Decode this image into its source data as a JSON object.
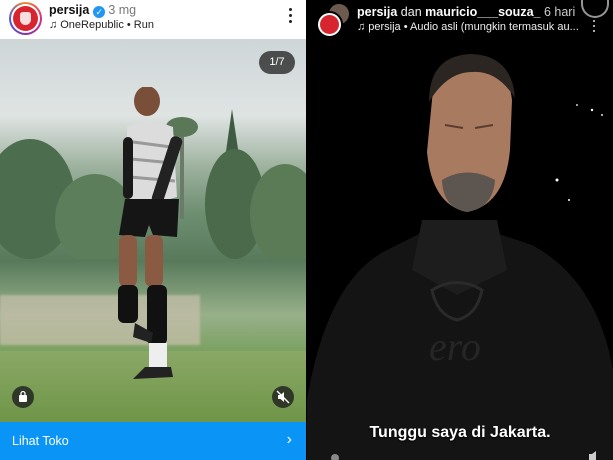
{
  "left_post": {
    "username": "persija",
    "verified_mark": "✓",
    "time_ago": "3 mg",
    "audio_icon": "♫",
    "audio": "OneRepublic • Run",
    "carousel_counter": "1/7",
    "shop_label": "Lihat Toko",
    "shop_chevron": "›",
    "icons": [
      "avatar",
      "verified-badge-icon",
      "music-note-icon",
      "more-options-icon",
      "shopping-bag-icon",
      "speaker-muted-icon",
      "chevron-right-icon"
    ]
  },
  "right_post": {
    "username": "persija",
    "joiner": "dan",
    "collaborator": "mauricio___souza_",
    "time_ago": "6 hari",
    "audio_icon": "♫",
    "audio": "persija • Audio asli (mungkin termasuk au...",
    "caption": "Tunggu saya di Jakarta.",
    "icons": [
      "avatar-stack",
      "music-note-icon",
      "club-crest-icon",
      "more-options-icon",
      "speaker-muted-icon"
    ]
  },
  "colors": {
    "accent_blue": "#0a95f6",
    "verified_blue": "#2196f3",
    "club_red": "#d7252f"
  }
}
